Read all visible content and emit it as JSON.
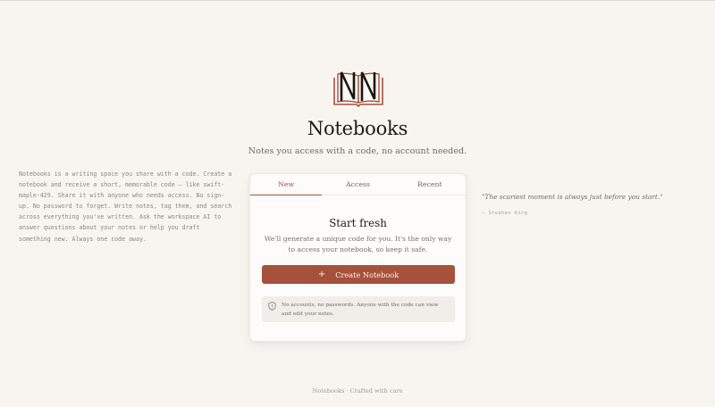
{
  "app": {
    "title": "Notebooks",
    "subtitle": "Notes you access with a code, no account needed.",
    "logo_icon": "open-book-logo-icon",
    "accent_color": "#a6513c"
  },
  "intro": {
    "text": "Notebooks is a writing space you share with a code. Create a notebook and receive a short, memorable code — like swift-maple-429. Share it with anyone who needs access. No sign-up. No password to forget. Write notes, tag them, and search across everything you've written. Ask the workspace AI to answer questions about your notes or help you draft something new. Always one code away."
  },
  "tabs": [
    {
      "label": "New",
      "active": true
    },
    {
      "label": "Access",
      "active": false
    },
    {
      "label": "Recent",
      "active": false
    }
  ],
  "new_panel": {
    "heading": "Start fresh",
    "description": "We'll generate a unique code for you. It's the only way to access your notebook, so keep it safe.",
    "create_button": {
      "label": "Create Notebook",
      "icon": "plus-icon"
    },
    "notice": {
      "icon": "shield-icon",
      "text": "No accounts, no passwords. Anyone with the code can view and edit your notes."
    }
  },
  "quote": {
    "text": "\"The scariest moment is always just before you start.\"",
    "author": "— Stephen King"
  },
  "footer": {
    "text": "Notebooks · Crafted with care"
  }
}
